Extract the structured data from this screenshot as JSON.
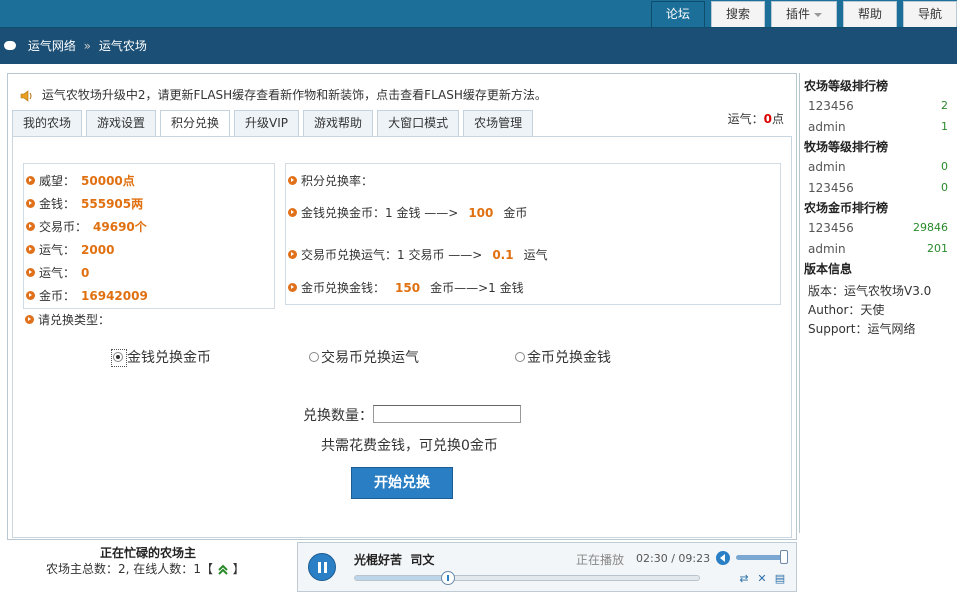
{
  "topnav": {
    "items": [
      {
        "label": "论坛",
        "active": true
      },
      {
        "label": "搜索",
        "active": false
      },
      {
        "label": "插件",
        "active": false,
        "has_dropdown": true
      },
      {
        "label": "帮助",
        "active": false
      },
      {
        "label": "导航",
        "active": false
      }
    ]
  },
  "breadcrumb": {
    "home": "运气网络",
    "separator": "»",
    "current": "运气农场"
  },
  "notice": "运气农牧场升级中2，请更新FLASH缓存查看新作物和新装饰，点击查看FLASH缓存更新方法。",
  "tabs": [
    {
      "label": "我的农场",
      "active": false
    },
    {
      "label": "游戏设置",
      "active": false
    },
    {
      "label": "积分兑换",
      "active": true
    },
    {
      "label": "升级VIP",
      "active": false
    },
    {
      "label": "游戏帮助",
      "active": false
    },
    {
      "label": "大窗口模式",
      "active": false
    },
    {
      "label": "农场管理",
      "active": false
    }
  ],
  "luck_display": {
    "label": "运气：",
    "value": "0",
    "unit": "点"
  },
  "stats": [
    {
      "label": "威望：",
      "value": "50000点"
    },
    {
      "label": "金钱：",
      "value": "555905两"
    },
    {
      "label": "交易币：",
      "value": "49690个"
    },
    {
      "label": "运气：",
      "value": "2000"
    },
    {
      "label": "运气：",
      "value": "0"
    },
    {
      "label": "金币：",
      "value": "16942009"
    }
  ],
  "rates": {
    "title": "积分兑换率：",
    "lines": [
      {
        "prefix": "金钱兑换金币：1 金钱 ——>",
        "value": "100",
        "suffix": "金币"
      },
      {
        "prefix": "交易币兑换运气：1 交易币 ——>",
        "value": "0.1",
        "suffix": "运气"
      },
      {
        "prefix": "金币兑换金钱：",
        "value": "150",
        "suffix": "金币——>1 金钱"
      }
    ]
  },
  "exchange": {
    "type_label": "请兑换类型：",
    "options": [
      {
        "label": "金钱兑换金币",
        "checked": true
      },
      {
        "label": "交易币兑换运气",
        "checked": false
      },
      {
        "label": "金币兑换金钱",
        "checked": false
      }
    ],
    "qty_label": "兑换数量：",
    "qty_value": "",
    "cost_text": "共需花费金钱，可兑换0金币",
    "start_button": "开始兑换"
  },
  "sidebar": {
    "farm_rank": {
      "title": "农场等级排行榜",
      "rows": [
        {
          "name": "123456",
          "value": "2"
        },
        {
          "name": "admin",
          "value": "1"
        }
      ]
    },
    "ranch_rank": {
      "title": "牧场等级排行榜",
      "rows": [
        {
          "name": "admin",
          "value": "0"
        },
        {
          "name": "123456",
          "value": "0"
        }
      ]
    },
    "gold_rank": {
      "title": "农场金币排行榜",
      "rows": [
        {
          "name": "123456",
          "value": "29846"
        },
        {
          "name": "admin",
          "value": "201"
        }
      ]
    },
    "version": {
      "title": "版本信息",
      "lines": [
        "版本：运气农牧场V3.0",
        "Author：天使",
        "Support：运气网络"
      ]
    }
  },
  "busy": {
    "title": "正在忙碌的农场主",
    "total_label": "农场主总数：",
    "total_value": "2,",
    "online_label": "在线人数：",
    "online_value": "1",
    "bracket_open": "【",
    "bracket_close": "】"
  },
  "player": {
    "song": "光棍好苦",
    "artist": "司文",
    "status": "正在播放",
    "time": "02:30 / 09:23",
    "progress_fraction": 0.27,
    "volume_fraction": 0.95
  },
  "colors": {
    "topbar": "#1c6f98",
    "breadbar": "#1b4f75",
    "accent_orange": "#e07010",
    "luck_red": "#dd0000",
    "button_blue": "#2a7fc4"
  }
}
